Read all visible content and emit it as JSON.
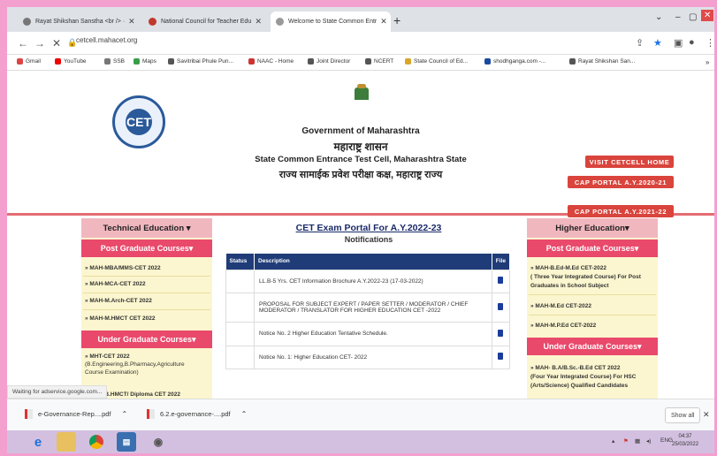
{
  "browser": {
    "tabs": [
      {
        "title": "Rayat Shikshan Sanstha <br /> ·"
      },
      {
        "title": "National Council for Teacher Edu"
      },
      {
        "title": "Welcome to State Common Entr"
      }
    ],
    "new_tab": "+",
    "url": "cetcell.mahacet.org",
    "bookmarks": [
      "Gmail",
      "YouTube",
      "SSB",
      "Maps",
      "Savitribai Phule Pun...",
      "NAAC - Home",
      "Joint Director",
      "NCERT",
      "State Council of Ed...",
      "shodhganga.com -...",
      "Rayat Shikshan San..."
    ]
  },
  "header": {
    "gov": "Government of Maharashtra",
    "marathi1": "महाराष्ट्र शासन",
    "cell": "State Common Entrance Test Cell, Maharashtra State",
    "marathi2": "राज्य सामाईक प्रवेश परीक्षा कक्ष, महाराष्ट्र राज्य",
    "logo_text": "CET",
    "buttons": [
      "VISIT CETCELL HOME",
      "CAP PORTAL A.Y.2020-21",
      "CAP PORTAL A.Y.2021-22"
    ]
  },
  "left": {
    "head": "Technical Education ▾",
    "pg": "Post Graduate Courses▾",
    "pg_links": [
      "» MAH-MBA/MMS-CET 2022",
      "» MAH-MCA-CET 2022",
      "» MAH-M.Arch-CET 2022",
      "» MAH-M.HMCT CET 2022"
    ],
    "ug": "Under Graduate Courses▾",
    "ug_links": [
      "» MHT-CET 2022",
      "(B.Engineering,B.Pharmacy,Agriculture",
      "Course Examination)",
      "» MAH-B.HMCT/ Diploma CET 2022"
    ]
  },
  "center": {
    "title": "CET Exam Portal For A.Y.2022-23",
    "subtitle": "Notifications",
    "columns": [
      "Status",
      "Description",
      "File"
    ],
    "rows": [
      "LL.B-5 Yrs. CET Information Brochure A.Y.2022-23 (17-03-2022)",
      "PROPOSAL FOR SUBJECT EXPERT / PAPER SETTER / MODERATOR / CHIEF MODERATOR / TRANSLATOR FOR HIGHER EDUCATION CET -2022",
      "Notice No. 2 Higher Education Tentative Schedule.",
      "Notice No. 1: Higher Education CET- 2022"
    ]
  },
  "right": {
    "head": "Higher Education▾",
    "pg": "Post Graduate Courses▾",
    "pg_links": [
      "» MAH-B.Ed-M.Ed CET-2022",
      "( Three Year Integrated Course) For Post",
      "Graduates in School Subject",
      "» MAH-M.Ed CET-2022",
      "» MAH-M.P.Ed CET-2022"
    ],
    "ug": "Under Graduate Courses▾",
    "ug_links": [
      "» MAH- B.A/B.Sc.-B.Ed CET 2022",
      "(Four Year Integrated Course) For HSC",
      "(Arts/Science) Qualified Candidates"
    ]
  },
  "status_text": "Waiting for adservice.google.com...",
  "downloads": {
    "items": [
      "e-Governance-Rep....pdf",
      "6.2.e-governance-....pdf"
    ],
    "show_all": "Show all",
    "close": "✕"
  },
  "taskbar": {
    "lang": "ENG",
    "time": "04:37",
    "date": "25/03/2022"
  },
  "colors": {
    "accent": "#e9496b",
    "nav": "#1f3c78",
    "side": "#fbf6cf"
  }
}
